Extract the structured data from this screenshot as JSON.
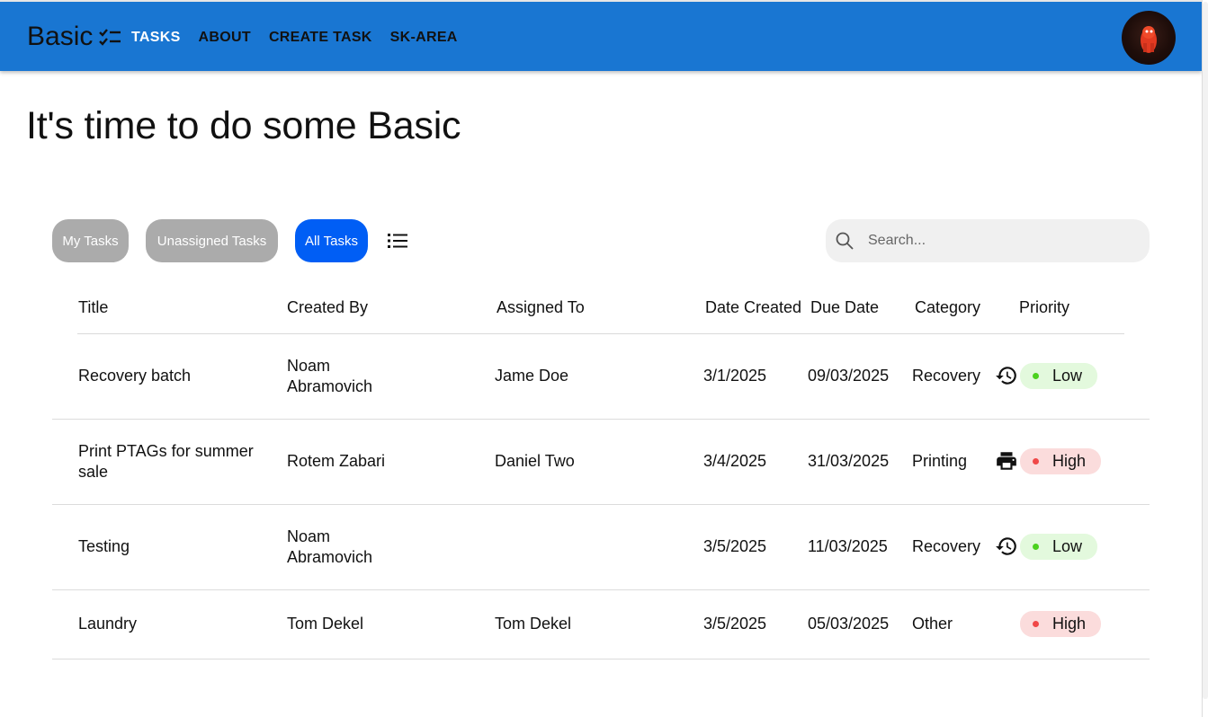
{
  "app": {
    "brand": "Basic",
    "nav": [
      {
        "label": "TASKS",
        "active": true
      },
      {
        "label": "ABOUT",
        "active": false
      },
      {
        "label": "CREATE TASK",
        "active": false
      },
      {
        "label": "SK-AREA",
        "active": false
      }
    ]
  },
  "page": {
    "headline": "It's time to do some Basic"
  },
  "filters": {
    "my_tasks": "My Tasks",
    "unassigned_tasks": "Unassigned Tasks",
    "all_tasks": "All Tasks",
    "selected": "All Tasks"
  },
  "search": {
    "placeholder": "Search...",
    "value": ""
  },
  "table": {
    "columns": [
      "Title",
      "Created By",
      "Assigned To",
      "Date Created",
      "Due Date",
      "Category",
      "Priority"
    ],
    "rows": [
      {
        "title_lines": [
          "Recovery batch"
        ],
        "created_by_lines": [
          "Noam",
          "Abramovich"
        ],
        "assigned_to": "Jame Doe",
        "date_created": "3/1/2025",
        "due_date": "09/03/2025",
        "category": "Recovery",
        "category_icon": "history-icon",
        "priority": "Low"
      },
      {
        "title_lines": [
          "Print PTAGs for summer",
          "sale"
        ],
        "created_by_lines": [
          "Rotem Zabari"
        ],
        "assigned_to": "Daniel Two",
        "date_created": "3/4/2025",
        "due_date": "31/03/2025",
        "category": "Printing",
        "category_icon": "printer-icon",
        "priority": "High"
      },
      {
        "title_lines": [
          "Testing"
        ],
        "created_by_lines": [
          "Noam",
          "Abramovich"
        ],
        "assigned_to": "",
        "date_created": "3/5/2025",
        "due_date": "11/03/2025",
        "category": "Recovery",
        "category_icon": "history-icon",
        "priority": "Low"
      },
      {
        "title_lines": [
          "Laundry"
        ],
        "created_by_lines": [
          "Tom Dekel"
        ],
        "assigned_to": "Tom Dekel",
        "date_created": "3/5/2025",
        "due_date": "05/03/2025",
        "category": "Other",
        "category_icon": "",
        "priority": "High"
      }
    ]
  },
  "colors": {
    "topbar": "#1976d2",
    "filter_active": "#005ef5",
    "filter_inactive": "#ababab",
    "priority_low_bg": "#e3f9dd",
    "priority_low_dot": "#4cd11f",
    "priority_high_bg": "#fbdcdc",
    "priority_high_dot": "#f04848"
  }
}
